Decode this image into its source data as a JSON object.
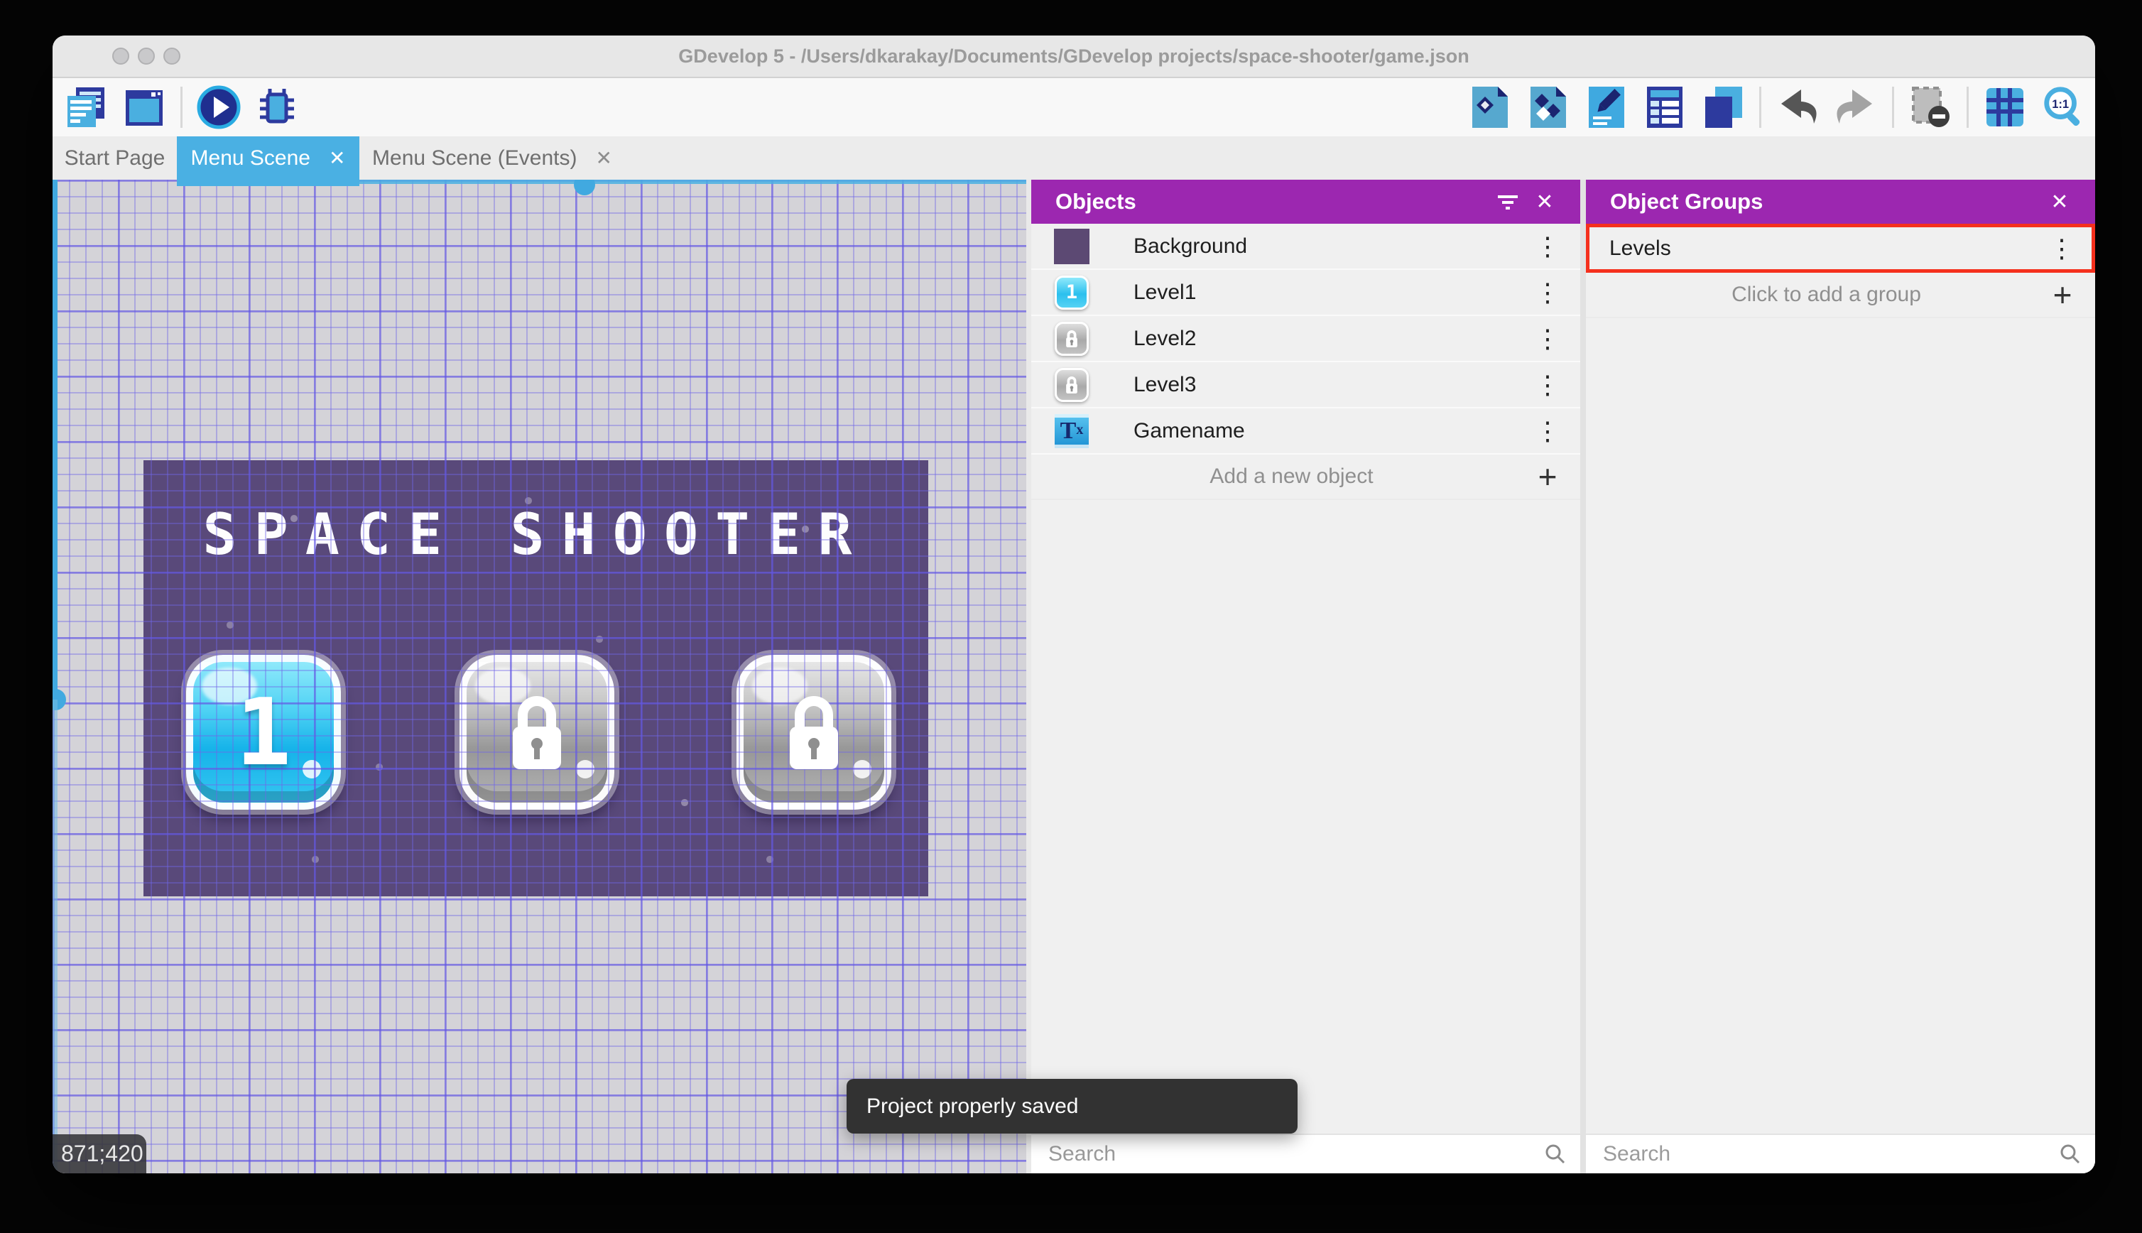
{
  "window": {
    "title": "GDevelop 5 - /Users/dkarakay/Documents/GDevelop projects/space-shooter/game.json"
  },
  "titlebar": {
    "traffic_lights": [
      "close",
      "minimize",
      "maximize"
    ]
  },
  "toolbar": {
    "left_icons": [
      "project-manager",
      "preview-window",
      "play-preview",
      "debug"
    ],
    "right_icons": [
      "objects-editor",
      "object-groups-editor",
      "properties",
      "instances-list",
      "layers-editor",
      "undo",
      "redo",
      "toggle-instances-mask",
      "grid",
      "zoom-one-to-one"
    ],
    "zoom_ratio_label": "1:1"
  },
  "tabs": [
    {
      "label": "Start Page",
      "active": false,
      "closable": false
    },
    {
      "label": "Menu Scene",
      "active": true,
      "closable": true
    },
    {
      "label": "Menu Scene (Events)",
      "active": false,
      "closable": true
    }
  ],
  "canvas": {
    "coordinates": "871;420",
    "scene": {
      "title": "SPACE SHOOTER",
      "buttons": [
        {
          "label": "1",
          "locked": false
        },
        {
          "label": "",
          "locked": true
        },
        {
          "label": "",
          "locked": true
        }
      ]
    }
  },
  "objects_panel": {
    "title": "Objects",
    "items": [
      {
        "name": "Background",
        "icon": "purple-color-swatch"
      },
      {
        "name": "Level1",
        "icon": "level1-button-sprite"
      },
      {
        "name": "Level2",
        "icon": "locked-button-sprite"
      },
      {
        "name": "Level3",
        "icon": "locked-button-sprite"
      },
      {
        "name": "Gamename",
        "icon": "text-object"
      }
    ],
    "add_button_label": "Add a new object",
    "search_placeholder": "Search"
  },
  "object_groups_panel": {
    "title": "Object Groups",
    "groups": [
      {
        "name": "Levels",
        "highlighted": true
      }
    ],
    "add_button_label": "Click to add a group",
    "search_placeholder": "Search"
  },
  "toast": {
    "message": "Project properly saved"
  },
  "icons": {
    "close": "✕",
    "plus": "+",
    "kebab": "⋮",
    "level1_digit": "1",
    "text_object_main": "T",
    "text_object_sub": "x"
  },
  "colors": {
    "accent_blue": "#4ab0e3",
    "header_purple": "#9c27b0",
    "highlight_red": "#f5301d",
    "toast_bg": "#323232",
    "scene_purple": "#59497a"
  }
}
